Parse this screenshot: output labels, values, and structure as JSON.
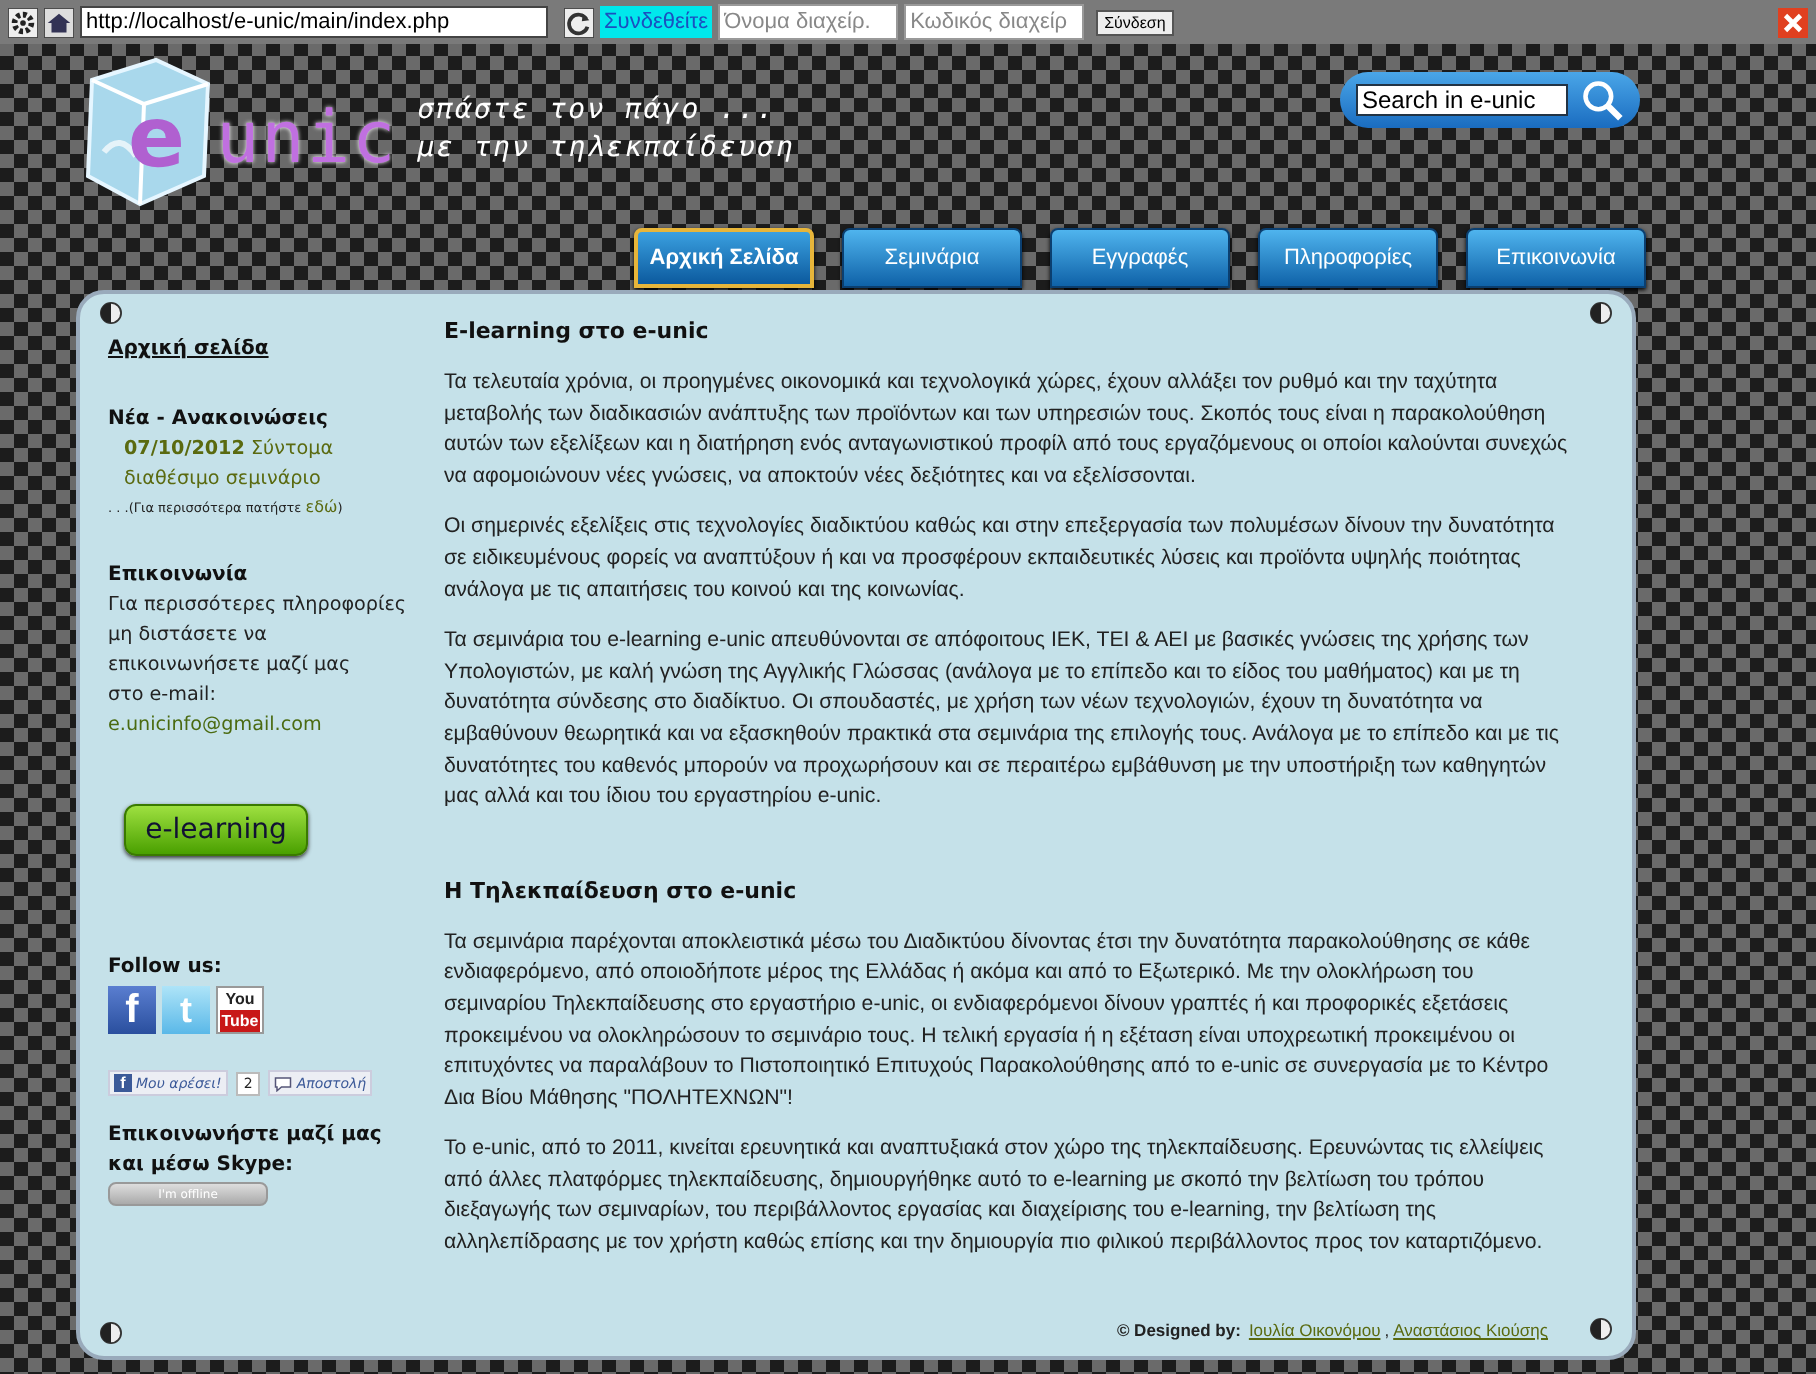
{
  "toolbar": {
    "url": "http://localhost/e-unic/main/index.php",
    "connect_label": "Συνδεθείτε",
    "username": {
      "placeholder": "Όνομα διαχείρ."
    },
    "password": {
      "placeholder": "Κωδικός διαχείρ"
    },
    "login_button": "Σύνδεση"
  },
  "header": {
    "logo_e": "e",
    "logo_rest": "unic",
    "tagline": [
      "σπάστε τον πάγο ...",
      "με την τηλεκπαίδευση"
    ],
    "search": {
      "value": "Search in e-unic"
    }
  },
  "nav": [
    {
      "label": "Αρχική Σελίδα",
      "selected": true
    },
    {
      "label": "Σεμινάρια",
      "selected": false
    },
    {
      "label": "Εγγραφές",
      "selected": false
    },
    {
      "label": "Πληροφορίες",
      "selected": false
    },
    {
      "label": "Επικοινωνία",
      "selected": false
    }
  ],
  "sidebar": {
    "home_link": "Αρχική σελίδα",
    "news": {
      "title": "Νέα - Ανακοινώσεις",
      "items": [
        {
          "date": "07/10/2012",
          "text": "Σύντομα διαθέσιμο σεμινάριο"
        }
      ],
      "more_prefix": ". . .(Για περισσότερα πατήστε ",
      "more_link": "εδώ",
      "more_suffix": ")"
    },
    "contact": {
      "title": "Επικοινωνία",
      "text": "Για περισσότερες πληροφορίες μη διστάσετε να επικοινωνήσετε μαζί μας",
      "email_label": "στο e-mail:",
      "email": "e.unicinfo@gmail.com"
    },
    "elearning_button": "e-learning",
    "follow": {
      "title": "Follow us:",
      "icons": [
        {
          "kind": "facebook",
          "glyph": "f"
        },
        {
          "kind": "twitter",
          "glyph": "t"
        },
        {
          "kind": "youtube",
          "glyph": "You",
          "glyph2": "Tube"
        }
      ]
    },
    "like": {
      "label": "Μου αρέσει!",
      "glyph": "f",
      "count": "2",
      "send": "Αποστολή"
    },
    "skype": {
      "title": "Επικοινωνήστε μαζί μας και μέσω Skype:",
      "status": "I'm offline"
    }
  },
  "main": {
    "sections": [
      {
        "title": "E-learning στο e-unic",
        "paragraphs": [
          "Τα τελευταία χρόνια, οι προηγμένες οικονομικά και τεχνολογικά χώρες, έχουν αλλάξει τον ρυθμό και την ταχύτητα μεταβολής των διαδικασιών ανάπτυξης των προϊόντων και των υπηρεσιών τους. Σκοπός τους είναι η παρακολούθηση αυτών των εξελίξεων και η διατήρηση ενός ανταγωνιστικού προφίλ από τους εργαζόμενους οι οποίοι καλούνται συνεχώς να αφομοιώνουν νέες γνώσεις, να αποκτούν νέες δεξιότητες και να εξελίσσονται.",
          "Οι σημερινές εξελίξεις στις τεχνολογίες διαδικτύου καθώς και στην επεξεργασία των πολυμέσων δίνουν την δυνατότητα σε ειδικευμένους φορείς να αναπτύξουν ή και να προσφέρουν εκπαιδευτικές λύσεις και προϊόντα υψηλής ποιότητας ανάλογα με τις απαιτήσεις του κοινού και της κοινωνίας.",
          "Τα σεμινάρια του e-learning e-unic απευθύνονται σε απόφοιτους ΙΕΚ, ΤΕΙ & ΑΕΙ με βασικές γνώσεις της χρήσης των Υπολογιστών, με καλή γνώση της Αγγλικής Γλώσσας (ανάλογα με το επίπεδο και το είδος του μαθήματος) και με τη δυνατότητα σύνδεσης στο διαδίκτυο. Οι σπουδαστές, με χρήση των νέων τεχνολογιών, έχουν τη δυνατότητα να εμβαθύνουν θεωρητικά και να εξασκηθούν πρακτικά στα σεμινάρια της επιλογής τους. Ανάλογα με το επίπεδο και με τις δυνατότητες του καθενός μπορούν να προχωρήσουν και σε περαιτέρω εμβάθυνση με την υποστήριξη των καθηγητών μας αλλά και του ίδιου του εργαστηρίου e-unic."
        ]
      },
      {
        "title": "Η Τηλεκπαίδευση στο e-unic",
        "paragraphs": [
          "Τα σεμινάρια παρέχονται αποκλειστικά μέσω του Διαδικτύου δίνοντας έτσι την δυνατότητα παρακολούθησης σε κάθε ενδιαφερόμενο, από οποιοδήποτε μέρος της Ελλάδας ή ακόμα και από το Εξωτερικό. Με την ολοκλήρωση του σεμιναρίου Τηλεκπαίδευσης στο εργαστήριο e-unic, οι ενδιαφερόμενοι δίνουν γραπτές ή και προφορικές εξετάσεις προκειμένου να ολοκληρώσουν το σεμινάριο τους. Η τελική εργασία ή η εξέταση είναι υποχρεωτική προκειμένου οι επιτυχόντες να παραλάβουν το Πιστοποιητικό Επιτυχούς Παρακολούθησης από το e-unic σε συνεργασία με το Κέντρο Δια Βίου Μάθησης \"ΠΟΛΗΤΕΧΝΩΝ\"!",
          "Το e-unic, από το 2011, κινείται ερευνητικά και αναπτυξιακά στον χώρο της τηλεκπαίδευσης. Ερευνώντας τις ελλείψεις από άλλες πλατφόρμες τηλεκπαίδευσης, δημιουργήθηκε αυτό το e-learning με σκοπό την βελτίωση του τρόπου διεξαγωγής των σεμιναρίων, του περιβάλλοντος εργασίας και διαχείρισης του e-learning, την βελτίωση της αλληλεπίδρασης με τον χρήστη καθώς επίσης και την δημιουργία πιο φιλικού περιβάλλοντος προς τον καταρτιζόμενο."
        ]
      }
    ]
  },
  "footer": {
    "prefix": "© Designed by:",
    "authors": [
      "Ιουλία Οικονόμου",
      "Αναστάσιος Κιούσης"
    ],
    "separator": ","
  }
}
